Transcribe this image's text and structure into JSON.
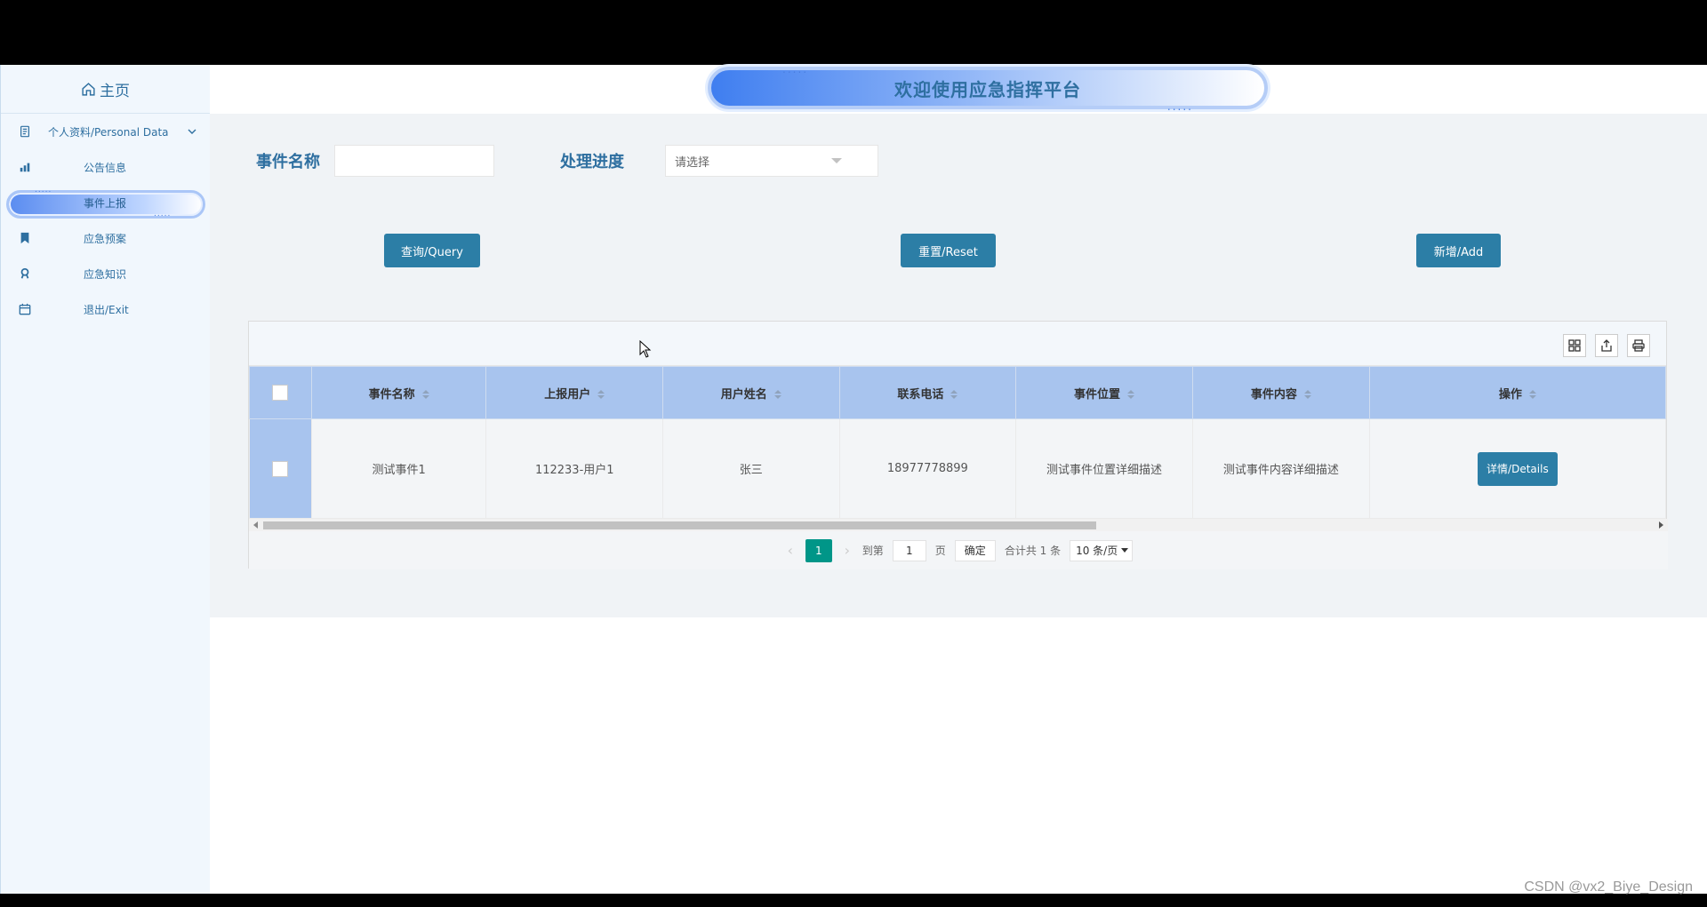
{
  "sidebar": {
    "home_label": "主页",
    "items": [
      {
        "label": "个人资料/Personal Data",
        "icon": "document-icon"
      },
      {
        "label": "公告信息",
        "icon": "megaphone-icon"
      },
      {
        "label": "事件上报",
        "icon": "",
        "active": true
      },
      {
        "label": "应急预案",
        "icon": "bookmark-icon"
      },
      {
        "label": "应急知识",
        "icon": "badge-icon"
      },
      {
        "label": "退出/Exit",
        "icon": "calendar-icon"
      }
    ],
    "active_dots": "....."
  },
  "header": {
    "title": "欢迎使用应急指挥平台",
    "dots": "....."
  },
  "search": {
    "name_label": "事件名称",
    "progress_label": "处理进度",
    "progress_placeholder": "请选择"
  },
  "buttons": {
    "query": "查询/Query",
    "reset": "重置/Reset",
    "add": "新增/Add"
  },
  "table": {
    "columns": [
      "事件名称",
      "上报用户",
      "用户姓名",
      "联系电话",
      "事件位置",
      "事件内容",
      "操作"
    ],
    "rows": [
      {
        "event_name": "测试事件1",
        "reporter": "112233-用户1",
        "user_name": "张三",
        "phone": "18977778899",
        "location": "测试事件位置详细描述",
        "content": "测试事件内容详细描述",
        "action": "详情/Details"
      }
    ]
  },
  "pagination": {
    "current": "1",
    "goto_label": "到第",
    "goto_value": "1",
    "page_unit": "页",
    "confirm": "确定",
    "total": "合计共 1 条",
    "page_size": "10 条/页"
  },
  "watermark": "CSDN @vx2_Biye_Design",
  "colors": {
    "primary_button": "#2c7ea6",
    "table_header": "#a8c4ee",
    "pager_active": "#009688",
    "label_text": "#2e6fa0"
  }
}
